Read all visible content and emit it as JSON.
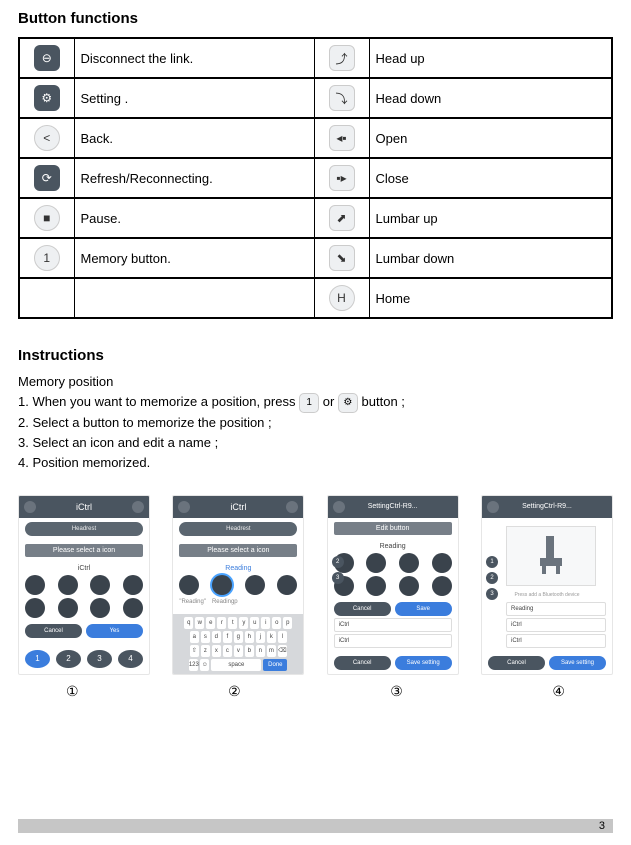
{
  "title_functions": "Button functions",
  "functions": {
    "left": [
      {
        "label": "Disconnect the link."
      },
      {
        "label": "Setting ."
      },
      {
        "label": "Back."
      },
      {
        "label": "Refresh/Reconnecting."
      },
      {
        "label": "Pause."
      },
      {
        "label": "Memory button."
      }
    ],
    "right": [
      {
        "label": "Head up"
      },
      {
        "label": "Head down"
      },
      {
        "label": "Open"
      },
      {
        "label": "Close"
      },
      {
        "label": "Lumbar up"
      },
      {
        "label": "Lumbar down"
      },
      {
        "label": "Home"
      }
    ]
  },
  "instructions_title": "Instructions",
  "memory_title": "Memory position",
  "memory_steps": {
    "s1a": "1. When you want to memorize a position,   press",
    "s1b": "or",
    "s1c": "button ;",
    "s2": "2. Select a button to memorize the position ;",
    "s3": "3. Select an icon and edit a name ;",
    "s4": "4. Position memorized."
  },
  "screenshots": {
    "app_title": "iCtrl",
    "headrest": "Headrest",
    "please_select": "Please select a icon",
    "ictrl_small": "iCtrl",
    "cancel": "Cancel",
    "yes": "Yes",
    "save": "Save",
    "reading": "Reading",
    "readingp": "Readingp",
    "reading_token1": "\"Reading\"",
    "edit_button": "Edit button",
    "setting_ctrl": "SettingCtrl-R9...",
    "save_setting": "Save setting",
    "press_bt": "Press add a Bluetooth device",
    "done": "Done",
    "space": "space"
  },
  "circled": {
    "n1": "①",
    "n2": "②",
    "n3": "③",
    "n4": "④"
  },
  "page_number": "3"
}
